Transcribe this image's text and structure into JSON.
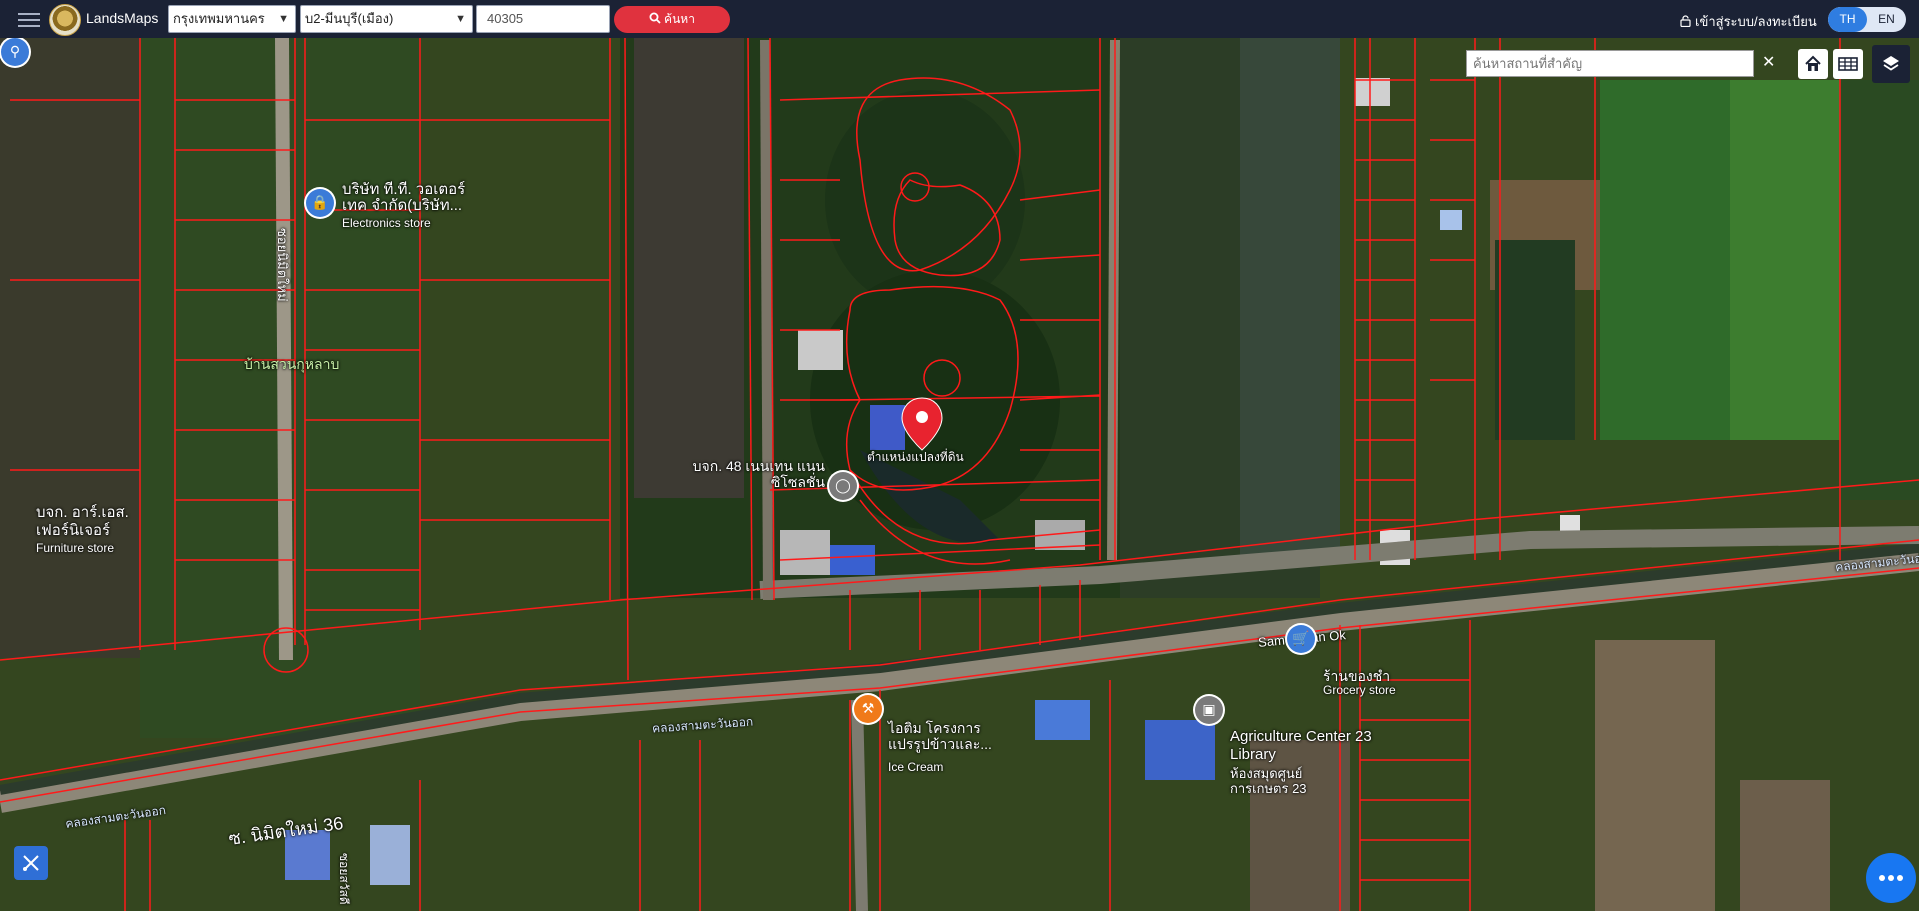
{
  "header": {
    "brand": "LandsMaps",
    "province": "กรุงเทพมหานคร",
    "district": "บ2-มีนบุรี(เมือง)",
    "parcel_number": "40305",
    "search_label": "ค้นหา",
    "login_label": "เข้าสู่ระบบ/ลงทะเบียน",
    "lang_th": "TH",
    "lang_en": "EN"
  },
  "map_controls": {
    "place_search_placeholder": "ค้นหาสถานที่สำคัญ"
  },
  "map_labels": {
    "parcel_marker": "ตำแหน่งแปลงที่ดิน",
    "electronics_name": "บริษัท ที.ที. วอเตอร์ เทค จำกัด(บริษัท...",
    "electronics_type": "Electronics store",
    "village": "บ้านสวนกุหลาบ",
    "soi_vertical": "ซอยนิมิตใหม่",
    "company_48": "บจก. 48 เนนเทน แนนซิโซลชั่น",
    "furniture_name": "บจก. อาร์.เอส. เฟอร์นิเจอร์",
    "furniture_type": "Furniture store",
    "sam_tawan": "Sam Tawan Ok",
    "grocery_name": "ร้านของชำ",
    "grocery_type": "Grocery store",
    "ice_cream_name": "ไอติม โครงการ แปรรูปข้าวและ...",
    "ice_cream_type": "Ice Cream",
    "library_name": "Agriculture Center 23 Library",
    "library_thai": "ห้องสมุดศูนย์ การเกษตร 23",
    "canal_1": "คลองสามตะวันออก",
    "canal_2": "คลองสามตะวันออก",
    "canal_3": "คลองสามตะวันออก",
    "road_main": "ซ. นิมิตใหม่ 36",
    "soi_lower": "ซอยสวัสดี"
  },
  "colors": {
    "topbar": "#1b2235",
    "search_button": "#e0323e",
    "lang_active": "#2f7de1",
    "parcel_line": "#ff1a1a",
    "marker": "#e8232f"
  }
}
